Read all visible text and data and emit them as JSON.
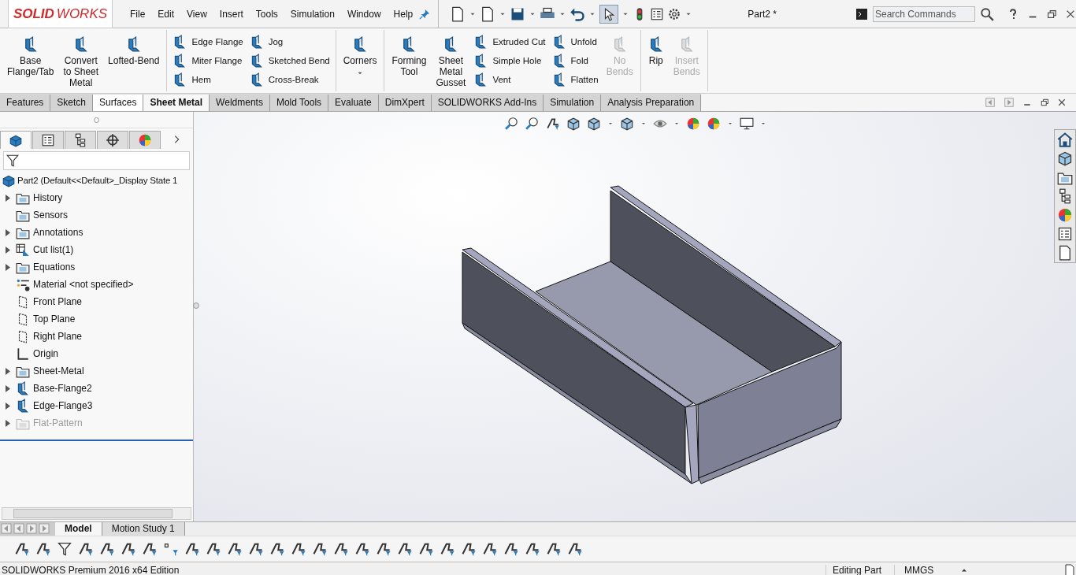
{
  "logo": {
    "text": "**SOLID**WORKS"
  },
  "menu": [
    "File",
    "Edit",
    "View",
    "Insert",
    "Tools",
    "Simulation",
    "Window",
    "Help"
  ],
  "quick_toolbar": {
    "select_active": true
  },
  "document_title": "Part2 *",
  "search": {
    "placeholder": "Search Commands"
  },
  "ribbon": {
    "groups": [
      {
        "columns": [
          {
            "kind": "large",
            "label": "Base\nFlange/Tab",
            "disabled": false
          },
          {
            "kind": "large",
            "label": "Convert\nto Sheet\nMetal",
            "disabled": false
          },
          {
            "kind": "large",
            "label": "Lofted-Bend",
            "disabled": false
          }
        ]
      },
      {
        "columns": [
          {
            "kind": "stack",
            "items": [
              "Edge Flange",
              "Miter Flange",
              "Hem"
            ]
          },
          {
            "kind": "stack",
            "items": [
              "Jog",
              "Sketched Bend",
              "Cross-Break"
            ]
          }
        ]
      },
      {
        "columns": [
          {
            "kind": "menu",
            "label": "Corners",
            "disabled": false
          }
        ]
      },
      {
        "columns": [
          {
            "kind": "large",
            "label": "Forming\nTool",
            "disabled": false
          },
          {
            "kind": "large",
            "label": "Sheet\nMetal\nGusset",
            "disabled": false
          },
          {
            "kind": "stack",
            "items": [
              "Extruded Cut",
              "Simple Hole",
              "Vent"
            ]
          },
          {
            "kind": "stack",
            "items": [
              "Unfold",
              "Fold",
              "Flatten"
            ]
          },
          {
            "kind": "large",
            "label": "No\nBends",
            "disabled": true
          }
        ]
      },
      {
        "columns": [
          {
            "kind": "large",
            "label": "Rip",
            "disabled": false
          },
          {
            "kind": "large",
            "label": "Insert\nBends",
            "disabled": true
          }
        ]
      }
    ]
  },
  "command_tabs": [
    {
      "label": "Features",
      "selected": false,
      "hovered": false
    },
    {
      "label": "Sketch",
      "selected": false,
      "hovered": false
    },
    {
      "label": "Surfaces",
      "selected": false,
      "hovered": true
    },
    {
      "label": "Sheet Metal",
      "selected": true,
      "hovered": false
    },
    {
      "label": "Weldments",
      "selected": false,
      "hovered": false
    },
    {
      "label": "Mold Tools",
      "selected": false,
      "hovered": false
    },
    {
      "label": "Evaluate",
      "selected": false,
      "hovered": false
    },
    {
      "label": "DimXpert",
      "selected": false,
      "hovered": false
    },
    {
      "label": "SOLIDWORKS Add-Ins",
      "selected": false,
      "hovered": false
    },
    {
      "label": "Simulation",
      "selected": false,
      "hovered": false
    },
    {
      "label": "Analysis Preparation",
      "selected": false,
      "hovered": false
    }
  ],
  "panel_tabs": [
    {
      "selected": true
    },
    {
      "selected": false
    },
    {
      "selected": false
    },
    {
      "selected": false
    },
    {
      "selected": false
    }
  ],
  "feature_tree": {
    "root": "Part2  (Default<<Default>_Display State 1",
    "items": [
      {
        "label": "History",
        "expandable": true,
        "disabled": false,
        "kind": "folder"
      },
      {
        "label": "Sensors",
        "expandable": false,
        "disabled": false,
        "kind": "folder"
      },
      {
        "label": "Annotations",
        "expandable": true,
        "disabled": false,
        "kind": "folder"
      },
      {
        "label": "Cut list(1)",
        "expandable": true,
        "disabled": false,
        "kind": "table"
      },
      {
        "label": "Equations",
        "expandable": true,
        "disabled": false,
        "kind": "folder"
      },
      {
        "label": "Material <not specified>",
        "expandable": false,
        "disabled": false,
        "kind": "material"
      },
      {
        "label": "Front Plane",
        "expandable": false,
        "disabled": false,
        "kind": "plane"
      },
      {
        "label": "Top Plane",
        "expandable": false,
        "disabled": false,
        "kind": "plane"
      },
      {
        "label": "Right Plane",
        "expandable": false,
        "disabled": false,
        "kind": "plane"
      },
      {
        "label": "Origin",
        "expandable": false,
        "disabled": false,
        "kind": "origin"
      },
      {
        "label": "Sheet-Metal",
        "expandable": true,
        "disabled": false,
        "kind": "folder"
      },
      {
        "label": "Base-Flange2",
        "expandable": true,
        "disabled": false,
        "kind": "feature"
      },
      {
        "label": "Edge-Flange3",
        "expandable": true,
        "disabled": false,
        "kind": "feature"
      },
      {
        "label": "Flat-Pattern",
        "expandable": true,
        "disabled": true,
        "kind": "folder"
      }
    ]
  },
  "bottom_tabs": [
    {
      "label": "Model",
      "selected": true
    },
    {
      "label": "Motion Study 1",
      "selected": false
    }
  ],
  "status_bar": {
    "edition": "SOLIDWORKS Premium 2016 x64 Edition",
    "mode": "Editing Part",
    "units": "MMGS"
  }
}
